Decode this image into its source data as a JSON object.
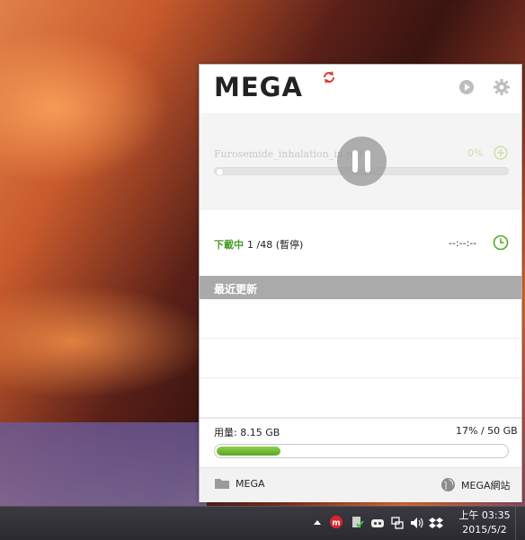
{
  "app": {
    "logo": "MEGA"
  },
  "transfer": {
    "filename": "Furosemide_inhalation_in.pdf",
    "percent": "0%",
    "progress_fraction": 0.02
  },
  "status": {
    "label": "下載中",
    "count": "1 /48 (暫停)",
    "time": "--:--:--"
  },
  "recent": {
    "title": "最近更新",
    "items": [
      "",
      "",
      ""
    ]
  },
  "usage": {
    "label": "用量: 8.15 GB",
    "summary": "17% / 50 GB",
    "fraction": 0.17
  },
  "footer": {
    "folder_label": "MEGA",
    "website_label": "MEGA網站"
  },
  "taskbar": {
    "time": "上午 03:35",
    "date": "2015/5/2"
  },
  "colors": {
    "accent_green": "#5aa626",
    "sync_red": "#e03a30"
  },
  "icons": [
    "sync-icon",
    "play-icon",
    "gear-icon",
    "pause-icon",
    "add-icon",
    "clock-icon",
    "folder-icon",
    "globe-icon"
  ]
}
